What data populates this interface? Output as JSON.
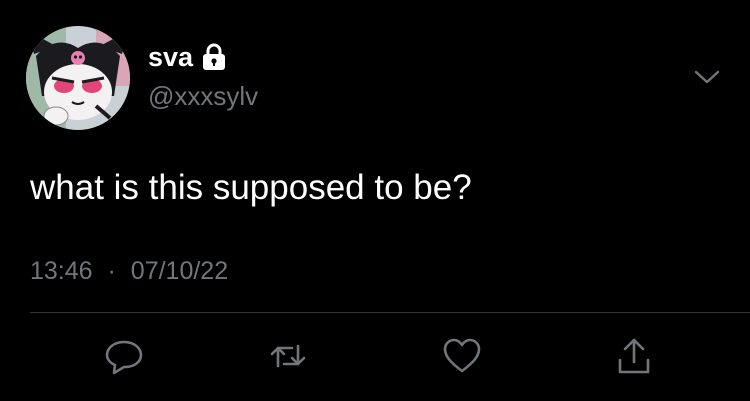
{
  "tweet": {
    "display_name": "sva",
    "handle": "@xxxsylv",
    "text": "what is this supposed to be?",
    "time": "13:46",
    "separator": "·",
    "date": "07/10/22",
    "verified_lock": "lock-icon"
  },
  "icons": {
    "avatar": "kuromi-avatar",
    "more": "chevron-down-icon",
    "reply": "reply-icon",
    "retweet": "retweet-icon",
    "like": "heart-icon",
    "share": "share-icon"
  },
  "colors": {
    "background": "#000000",
    "primary_text": "#ffffff",
    "secondary_text": "#71767b",
    "divider": "#2f3336"
  }
}
